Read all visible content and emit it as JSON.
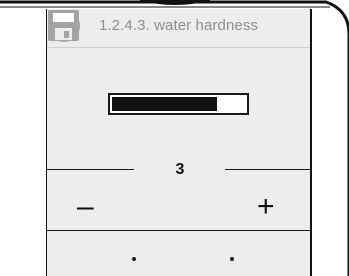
{
  "screen": {
    "title": "1.2.4.3. water hardness",
    "level_fraction": 0.79,
    "value": "3",
    "decrease_label": "–",
    "increase_label": "+"
  },
  "footer": {
    "back_icon": "back-arrow-icon",
    "save_icon": "floppy-disk-icon",
    "separator": "·"
  },
  "colors": {
    "screen_bg": "#ededed",
    "icon_gray": "#a3a3a3",
    "text_muted": "#8e8e8e",
    "ink": "#111111"
  }
}
